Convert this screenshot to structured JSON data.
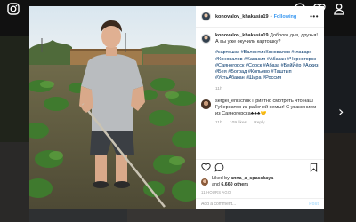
{
  "colors": {
    "accent": "#3897f0",
    "hashtag": "#003569",
    "meta": "#999999",
    "modal_bg": "#ffffff"
  },
  "top_icons": [
    "instagram-icon",
    "compass-icon",
    "heart-icon",
    "user-icon"
  ],
  "post": {
    "author": "konovalov_khakasia19",
    "dot": "•",
    "follow_label": "Following",
    "more": "•••",
    "caption": {
      "text": "Доброго дня, друзья! А вы уже окучили картошку?",
      "hashtags": "#картошка #ВалентинКоновалов #главарх #Коновалов #Хакасия #Абакан #Черногорск #Саяногорск #Сорск #Абаза #БейЙёр #Аскиз #Бея #Боград #Копьево #Таштып #УстьАбакан #Шира #Россия",
      "age": "11h"
    },
    "comment": {
      "user": "sergei_enischuk",
      "text": "Приятно смотреть что наш Губернатор из рабочей семьи! С уважением из Саяногорска♣♣♣🤝",
      "age": "11h",
      "likes": "109 likes",
      "reply": "Reply"
    },
    "liked_by": {
      "prefix": "Liked by",
      "user": "anna_a_spasskaya",
      "and": "and",
      "others": "6,660 others"
    },
    "time": "11 HOURS AGO",
    "add_comment_placeholder": "Add a comment...",
    "post_button": "Post"
  },
  "nav": {
    "prev": "‹",
    "next": "›"
  }
}
